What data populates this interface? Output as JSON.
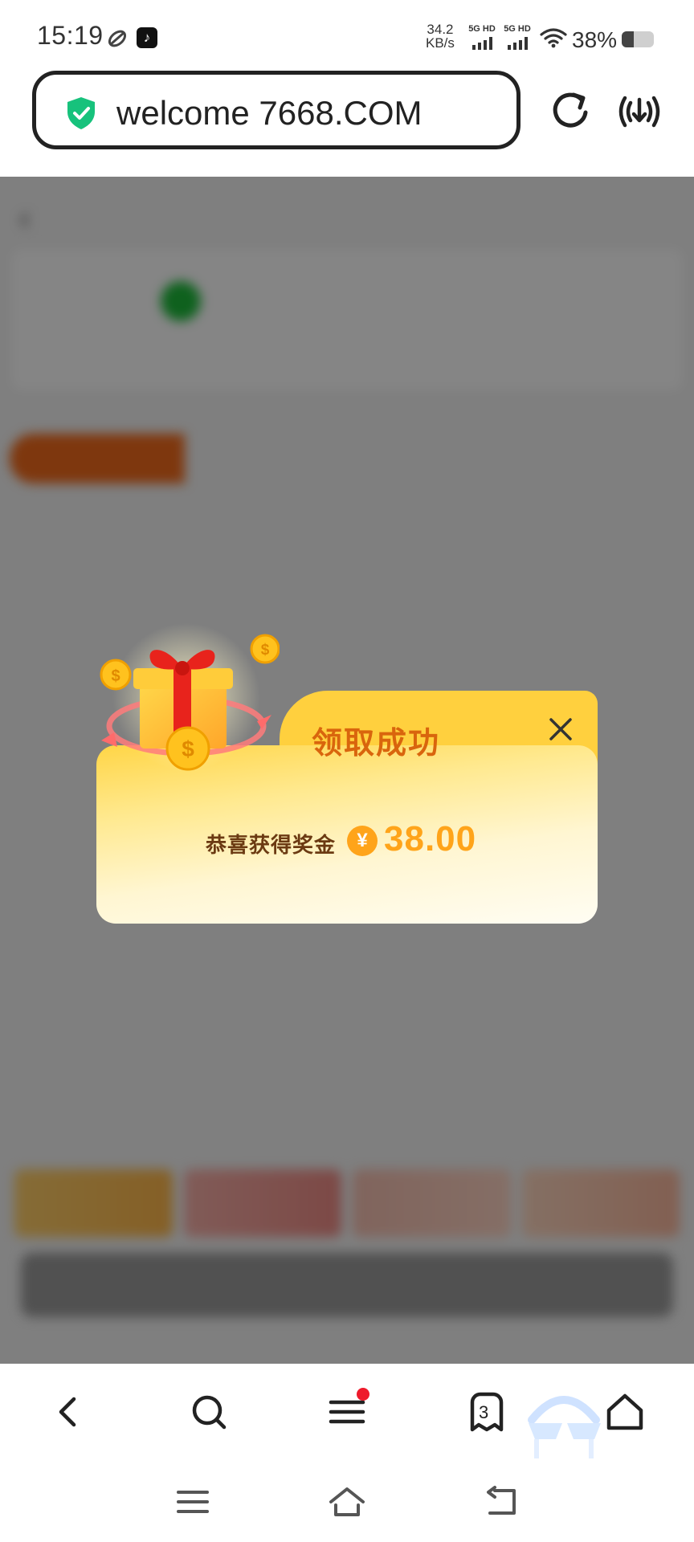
{
  "status_bar": {
    "time": "15:19",
    "net_speed_value": "34.2",
    "net_speed_unit": "KB/s",
    "sim1": "5G HD",
    "sim2": "5G HD",
    "battery_text": "38%",
    "battery_level": 0.38,
    "app_icons": [
      "link-icon",
      "tiktok-icon"
    ]
  },
  "browser": {
    "url_text": "welcome 7668.COM",
    "secure_icon": "shield-check-icon",
    "actions": [
      "reload-icon",
      "broadcast-download-icon"
    ],
    "bottom_nav": {
      "items": [
        "back-icon",
        "search-icon",
        "menu-icon",
        "tabs-icon",
        "home-icon"
      ],
      "tab_count": "3",
      "menu_has_notification": true
    }
  },
  "popup": {
    "title": "领取成功",
    "message": "恭喜获得奖金",
    "currency_symbol": "¥",
    "amount": "38.00",
    "close_icon": "close-icon",
    "illustration": "gift-box-with-coins",
    "colors": {
      "title": "#d9650d",
      "amount": "#ffa41a",
      "panel": "#ffd03e"
    }
  },
  "background_page": {
    "blurred": true,
    "title": "",
    "rule_link": "",
    "card_title": "",
    "card_sub": "",
    "card_highlight": "",
    "tag": "",
    "intro": "",
    "list": [],
    "action_button": ""
  },
  "system_nav": [
    "recents-icon",
    "home-icon",
    "back-icon"
  ]
}
